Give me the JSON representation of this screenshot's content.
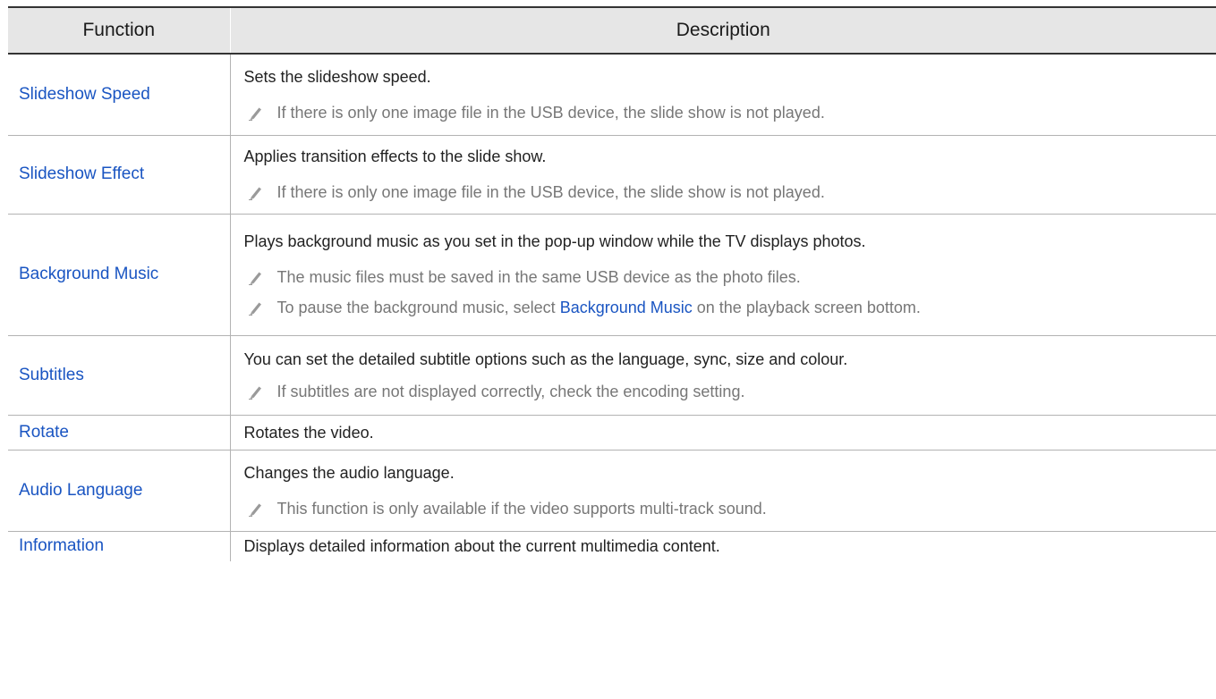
{
  "headers": {
    "function": "Function",
    "description": "Description"
  },
  "rows": [
    {
      "function": "Slideshow Speed",
      "description": "Sets the slideshow speed.",
      "notes": [
        "If there is only one image file in the USB device, the slide show is not played."
      ]
    },
    {
      "function": "Slideshow Effect",
      "description": "Applies transition effects to the slide show.",
      "notes": [
        "If there is only one image file in the USB device, the slide show is not played."
      ]
    },
    {
      "function": "Background Music",
      "description": "Plays background music as you set in the pop-up window while the TV displays photos.",
      "notes": [
        "The music files must be saved in the same USB device as the photo files."
      ],
      "note2": {
        "before": "To pause the background music, select ",
        "highlight": "Background Music",
        "after": " on the playback screen bottom."
      }
    },
    {
      "function": "Subtitles",
      "description": "You can set the detailed subtitle options such as the language, sync, size and colour.",
      "notes": [
        "If subtitles are not displayed correctly, check the encoding setting."
      ]
    },
    {
      "function": "Rotate",
      "description": "Rotates the video."
    },
    {
      "function": "Audio Language",
      "description": "Changes the audio language.",
      "notes": [
        "This function is only available if the video supports multi-track sound."
      ]
    },
    {
      "function": "Information",
      "description": "Displays detailed information about the current multimedia content."
    }
  ],
  "colors": {
    "function_text": "#1a55c2",
    "note_text": "#777777",
    "header_bg": "#e6e6e6"
  },
  "icons": {
    "note": "pencil-note-icon"
  }
}
